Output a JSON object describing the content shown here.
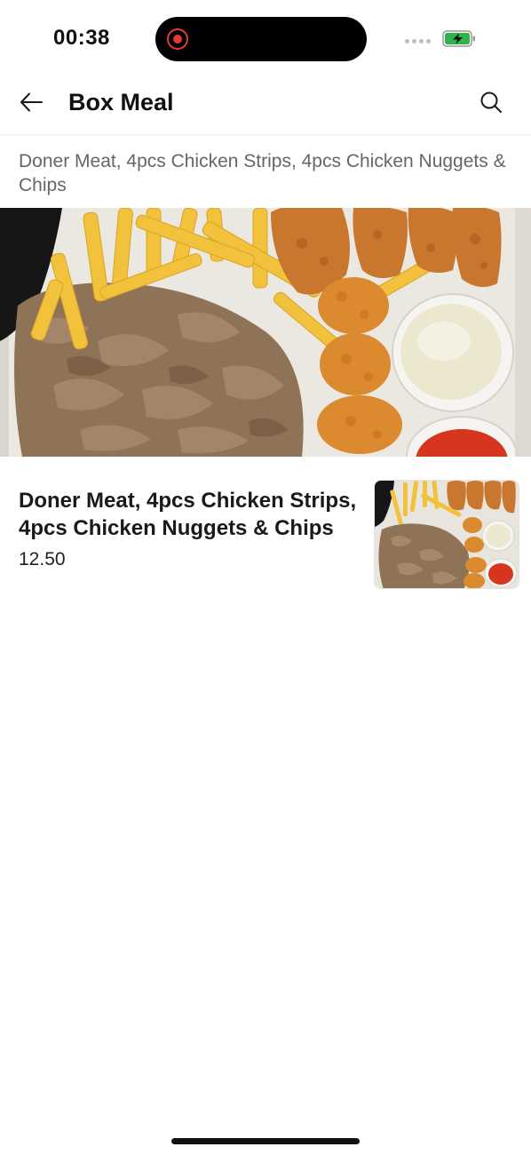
{
  "status_bar": {
    "time": "00:38",
    "battery_color": "#2fb34a"
  },
  "header": {
    "title": "Box Meal",
    "back_icon": "arrow-left-icon",
    "search_icon": "search-icon"
  },
  "category": {
    "description": "Doner Meat, 4pcs Chicken Strips, 4pcs Chicken Nuggets & Chips"
  },
  "products": [
    {
      "name": "Doner Meat, 4pcs Chicken Strips, 4pcs Chicken Nuggets & Chips",
      "price": "12.50"
    }
  ]
}
